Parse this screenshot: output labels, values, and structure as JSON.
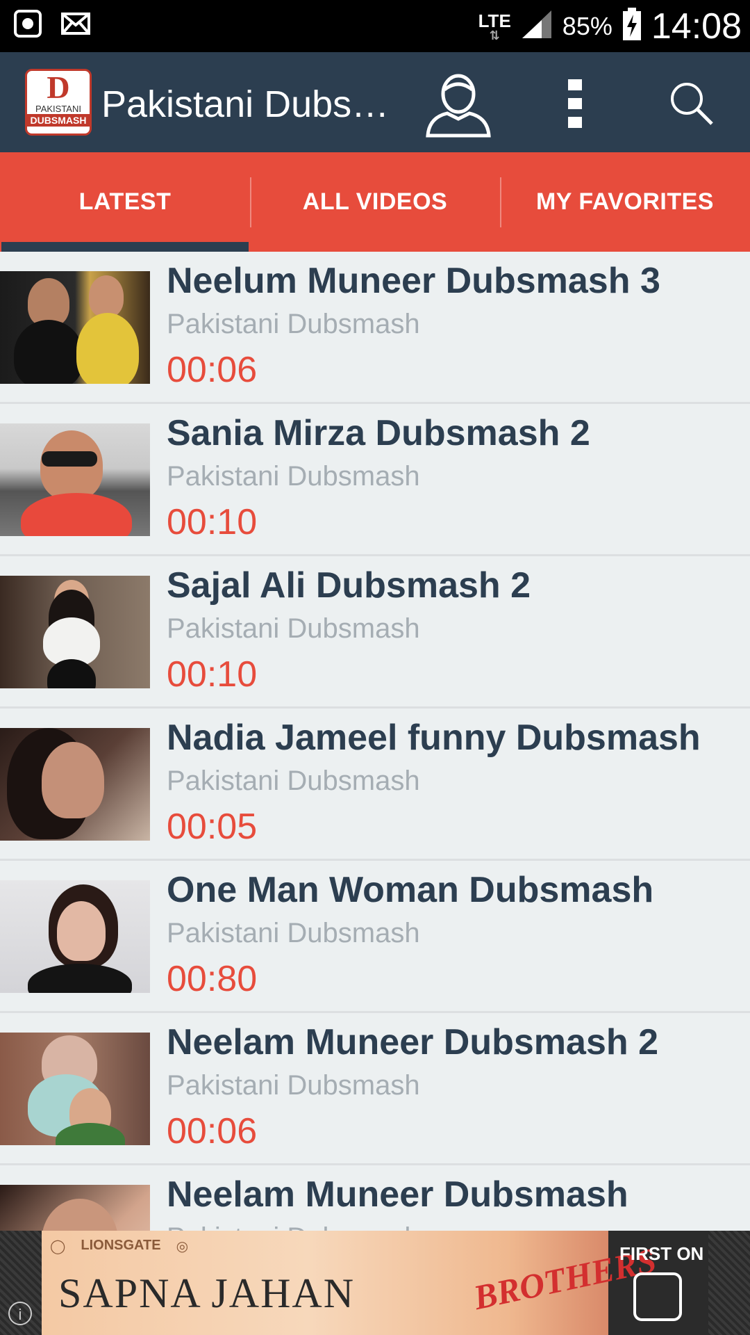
{
  "status_bar": {
    "network": "LTE",
    "battery": "85%",
    "time": "14:08"
  },
  "app_bar": {
    "title": "Pakistani Dubs…",
    "logo_letter": "D",
    "logo_line1": "PAKISTANI",
    "logo_line2": "DUBSMASH"
  },
  "tabs": [
    {
      "label": "LATEST",
      "active": true
    },
    {
      "label": "ALL VIDEOS",
      "active": false
    },
    {
      "label": "MY FAVORITES",
      "active": false
    }
  ],
  "videos": [
    {
      "title": "Neelum Muneer Dubsmash 3",
      "channel": "Pakistani Dubsmash",
      "duration": "00:06"
    },
    {
      "title": "Sania Mirza Dubsmash 2",
      "channel": "Pakistani Dubsmash",
      "duration": "00:10"
    },
    {
      "title": "Sajal Ali Dubsmash 2",
      "channel": "Pakistani Dubsmash",
      "duration": "00:10"
    },
    {
      "title": "Nadia Jameel funny Dubsmash",
      "channel": "Pakistani Dubsmash",
      "duration": "00:05"
    },
    {
      "title": "One Man Woman Dubsmash",
      "channel": "Pakistani Dubsmash",
      "duration": "00:80"
    },
    {
      "title": "Neelam Muneer Dubsmash 2",
      "channel": "Pakistani Dubsmash",
      "duration": "00:06"
    },
    {
      "title": "Neelam Muneer Dubsmash",
      "channel": "Pakistani Dubsmash",
      "duration": ""
    }
  ],
  "ad": {
    "logo1": "LIONSGATE",
    "title": "SAPNA JAHAN",
    "movie": "BROTHERS",
    "first_on": "FIRST ON"
  },
  "colors": {
    "appbar": "#2c3e50",
    "tabs": "#e74c3c",
    "title_text": "#2c3e50",
    "duration_text": "#e74c3c"
  }
}
